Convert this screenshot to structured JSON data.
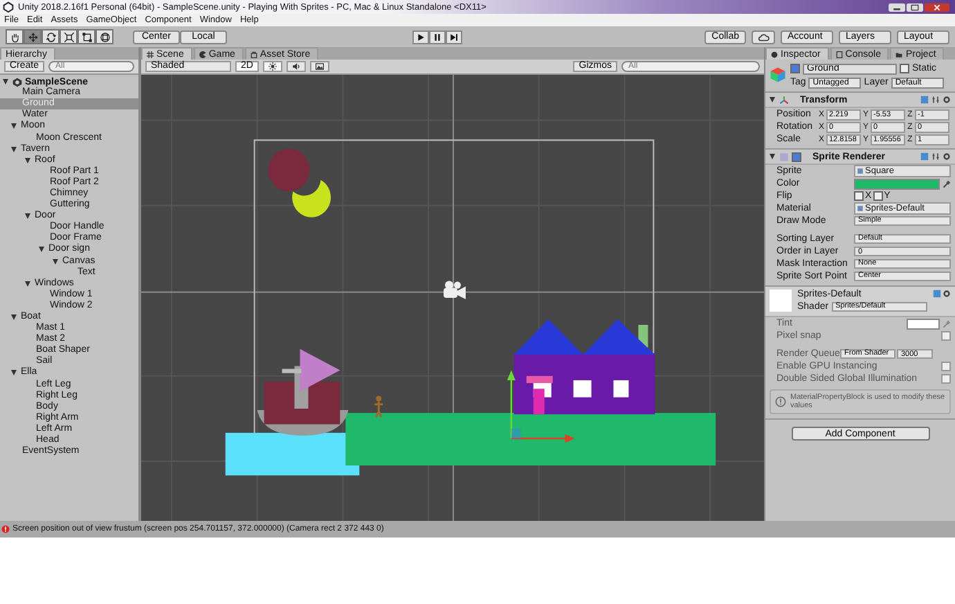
{
  "window": {
    "title": "Unity 2018.2.16f1 Personal (64bit) - SampleScene.unity - Playing With Sprites - PC, Mac & Linux Standalone <DX11>"
  },
  "menu": [
    "File",
    "Edit",
    "Assets",
    "GameObject",
    "Component",
    "Window",
    "Help"
  ],
  "toolbar": {
    "tools": [
      {
        "kind": "hand",
        "selected": false
      },
      {
        "kind": "move",
        "selected": true
      },
      {
        "kind": "rotate",
        "selected": false
      },
      {
        "kind": "scale",
        "selected": false
      },
      {
        "kind": "rect",
        "selected": false
      },
      {
        "kind": "transform",
        "selected": false
      }
    ],
    "pivot": [
      "Center",
      "Local"
    ],
    "collab": "Collab",
    "account": "Account",
    "layers": "Layers",
    "layout": "Layout"
  },
  "hierarchy": {
    "tab": "Hierarchy",
    "create": "Create",
    "search_placeholder": "All",
    "scene": {
      "name": "SampleScene",
      "expanded": true
    },
    "items": [
      {
        "name": "Main Camera",
        "selected": false
      },
      {
        "name": "Ground",
        "selected": true
      },
      {
        "name": "Water",
        "selected": false
      },
      {
        "name": "Moon",
        "selected": false,
        "expanded": true,
        "children": [
          {
            "name": "Moon Crescent",
            "selected": false
          }
        ]
      },
      {
        "name": "Tavern",
        "selected": false,
        "expanded": true,
        "children": [
          {
            "name": "Roof",
            "selected": false,
            "expanded": true,
            "children": [
              {
                "name": "Roof Part 1",
                "selected": false
              },
              {
                "name": "Roof Part 2",
                "selected": false
              },
              {
                "name": "Chimney",
                "selected": false
              },
              {
                "name": "Guttering",
                "selected": false
              }
            ]
          },
          {
            "name": "Door",
            "selected": false,
            "expanded": true,
            "children": [
              {
                "name": "Door Handle",
                "selected": false
              },
              {
                "name": "Door Frame",
                "selected": false
              },
              {
                "name": "Door sign",
                "selected": false,
                "expanded": true,
                "children": [
                  {
                    "name": "Canvas",
                    "selected": false,
                    "expanded": true,
                    "children": [
                      {
                        "name": "Text",
                        "selected": false
                      }
                    ]
                  }
                ]
              }
            ]
          },
          {
            "name": "Windows",
            "selected": false,
            "expanded": true,
            "children": [
              {
                "name": "Window 1",
                "selected": false
              },
              {
                "name": "Window 2",
                "selected": false
              }
            ]
          }
        ]
      },
      {
        "name": "Boat",
        "selected": false,
        "expanded": true,
        "children": [
          {
            "name": "Mast 1",
            "selected": false
          },
          {
            "name": "Mast 2",
            "selected": false
          },
          {
            "name": "Boat Shaper",
            "selected": false
          },
          {
            "name": "Sail",
            "selected": false
          }
        ]
      },
      {
        "name": "Ella",
        "selected": false,
        "expanded": true,
        "children": [
          {
            "name": "Left Leg",
            "selected": false
          },
          {
            "name": "Right Leg",
            "selected": false
          },
          {
            "name": "Body",
            "selected": false
          },
          {
            "name": "Right Arm",
            "selected": false
          },
          {
            "name": "Left Arm",
            "selected": false
          },
          {
            "name": "Head",
            "selected": false
          }
        ]
      },
      {
        "name": "EventSystem",
        "selected": false
      }
    ]
  },
  "scene_view": {
    "tabs": [
      {
        "label": "Scene",
        "kind": "scene",
        "selected": true
      },
      {
        "label": "Game",
        "kind": "game",
        "selected": false
      },
      {
        "label": "Asset Store",
        "kind": "store",
        "selected": false
      }
    ],
    "shading": "Shaded",
    "mode": "2D",
    "mode_on": true,
    "lighting_on": true,
    "audio_on": false,
    "gizmos": "Gizmos",
    "search_placeholder": "All"
  },
  "inspector": {
    "tabs": [
      {
        "label": "Inspector",
        "kind": "inspector",
        "selected": true
      },
      {
        "label": "Console",
        "kind": "console",
        "selected": false
      },
      {
        "label": "Project",
        "kind": "project",
        "selected": false
      }
    ],
    "object": {
      "name": "Ground",
      "active": true,
      "static_label": "Static",
      "static": false,
      "tag_label": "Tag",
      "tag": "Untagged",
      "layer_label": "Layer",
      "layer": "Default"
    },
    "transform": {
      "title": "Transform",
      "rows": [
        {
          "label": "Position",
          "axes": [
            {
              "label": "X",
              "value": "2.219"
            },
            {
              "label": "Y",
              "value": "-5.53"
            },
            {
              "label": "Z",
              "value": "-1"
            }
          ]
        },
        {
          "label": "Rotation",
          "axes": [
            {
              "label": "X",
              "value": "0"
            },
            {
              "label": "Y",
              "value": "0"
            },
            {
              "label": "Z",
              "value": "0"
            }
          ]
        },
        {
          "label": "Scale",
          "axes": [
            {
              "label": "X",
              "value": "12.8158"
            },
            {
              "label": "Y",
              "value": "1.95556"
            },
            {
              "label": "Z",
              "value": "1"
            }
          ]
        }
      ]
    },
    "sprite_renderer": {
      "title": "Sprite Renderer",
      "enabled": true,
      "fields": [
        {
          "kind": "object",
          "label": "Sprite",
          "value": "Square"
        },
        {
          "kind": "color",
          "label": "Color",
          "color": "#22b86a"
        },
        {
          "kind": "flip",
          "label": "Flip",
          "x_label": "X",
          "x": false,
          "y_label": "Y",
          "y": false
        },
        {
          "kind": "object",
          "label": "Material",
          "value": "Sprites-Default"
        },
        {
          "kind": "dropdown",
          "label": "Draw Mode",
          "value": "Simple"
        },
        {
          "kind": "spacer"
        },
        {
          "kind": "dropdown",
          "label": "Sorting Layer",
          "value": "Default"
        },
        {
          "kind": "text",
          "label": "Order in Layer",
          "value": "0"
        },
        {
          "kind": "dropdown",
          "label": "Mask Interaction",
          "value": "None"
        },
        {
          "kind": "dropdown",
          "label": "Sprite Sort Point",
          "value": "Center"
        }
      ]
    },
    "material": {
      "name": "Sprites-Default",
      "shader_label": "Shader",
      "shader": "Sprites/Default",
      "fields": [
        {
          "kind": "color",
          "label": "Tint",
          "color": "#ffffff"
        },
        {
          "kind": "checkbox",
          "label": "Pixel snap",
          "checked": false
        },
        {
          "kind": "spacer"
        },
        {
          "kind": "queue",
          "label": "Render Queue",
          "value": "From Shader",
          "number": "3000"
        },
        {
          "kind": "checkbox",
          "label": "Enable GPU Instancing",
          "checked": false
        },
        {
          "kind": "checkbox",
          "label": "Double Sided Global Illumination",
          "checked": false
        }
      ],
      "info": "MaterialPropertyBlock is used to modify these values"
    },
    "add_component": "Add Component"
  },
  "status_bar": {
    "message": "Screen position out of view frustum (screen pos 254.701157, 372.000000) (Camera rect 2 372 443 0)"
  }
}
